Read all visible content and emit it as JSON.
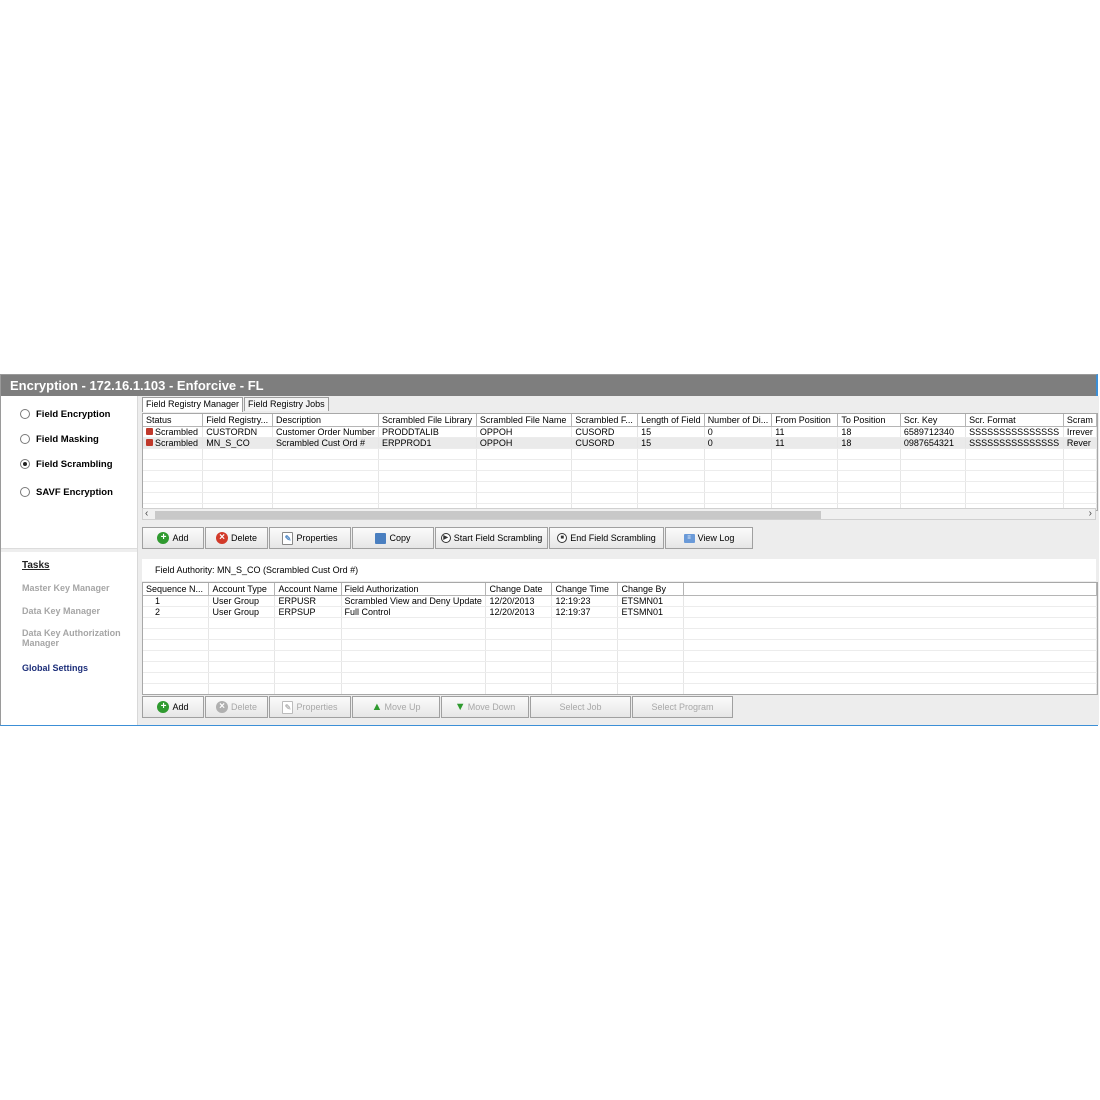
{
  "window": {
    "title": "Encryption - 172.16.1.103 - Enforcive - FL"
  },
  "left_panel": {
    "options": [
      {
        "label": "Field Encryption",
        "selected": false
      },
      {
        "label": "Field Masking",
        "selected": false
      },
      {
        "label": "Field Scrambling",
        "selected": true
      },
      {
        "label": "SAVF Encryption",
        "selected": false
      }
    ],
    "tasks_heading": "Tasks",
    "tasks": [
      {
        "label": "Master Key Manager",
        "enabled": false
      },
      {
        "label": "Data Key Manager",
        "enabled": false
      },
      {
        "label": "Data Key Authorization Manager",
        "enabled": false
      },
      {
        "label": "Global Settings",
        "enabled": true
      }
    ]
  },
  "tabs": [
    {
      "label": "Field Registry Manager",
      "active": true
    },
    {
      "label": "Field Registry Jobs",
      "active": false
    }
  ],
  "registry_grid": {
    "columns": [
      "Status",
      "Field Registry...",
      "Description",
      "Scrambled File Library",
      "Scrambled File Name",
      "Scrambled F...",
      "Length of Field",
      "Number of Di...",
      "From Position",
      "To Position",
      "Scr. Key",
      "Scr. Format",
      "Scram"
    ],
    "rows": [
      [
        "Scrambled",
        "CUSTORDN",
        "Customer Order Number",
        "PRODDTALIB",
        "OPPOH",
        "CUSORD",
        "15",
        "0",
        "11",
        "18",
        "6589712340",
        "SSSSSSSSSSSSSSS",
        "Irrever"
      ],
      [
        "Scrambled",
        "MN_S_CO",
        "Scrambled Cust Ord #",
        "ERPPROD1",
        "OPPOH",
        "CUSORD",
        "15",
        "0",
        "11",
        "18",
        "0987654321",
        "SSSSSSSSSSSSSSS",
        "Rever"
      ]
    ],
    "selected_row": 1,
    "status_icon": "lock-icon"
  },
  "toolbar_top": {
    "buttons": [
      {
        "label": "Add",
        "icon": "plus-icon"
      },
      {
        "label": "Delete",
        "icon": "delete-icon"
      },
      {
        "label": "Properties",
        "icon": "properties-icon"
      },
      {
        "label": "Copy",
        "icon": "copy-icon"
      },
      {
        "label": "Start Field Scrambling",
        "icon": "play-icon"
      },
      {
        "label": "End Field Scrambling",
        "icon": "stop-icon"
      },
      {
        "label": "View Log",
        "icon": "log-icon"
      }
    ]
  },
  "field_authority": {
    "label": "Field Authority:",
    "value": "MN_S_CO (Scrambled Cust Ord #)"
  },
  "authority_grid": {
    "columns": [
      "Sequence N...",
      "Account Type",
      "Account Name",
      "Field Authorization",
      "Change Date",
      "Change Time",
      "Change By"
    ],
    "rows": [
      [
        "1",
        "User Group",
        "ERPUSR",
        "Scrambled View and Deny Update",
        "12/20/2013",
        "12:19:23",
        "ETSMN01"
      ],
      [
        "2",
        "User Group",
        "ERPSUP",
        "Full Control",
        "12/20/2013",
        "12:19:37",
        "ETSMN01"
      ]
    ]
  },
  "toolbar_bottom": {
    "buttons": [
      {
        "label": "Add",
        "icon": "plus-icon",
        "enabled": true
      },
      {
        "label": "Delete",
        "icon": "delete-icon",
        "enabled": false
      },
      {
        "label": "Properties",
        "icon": "properties-icon",
        "enabled": false
      },
      {
        "label": "Move Up",
        "icon": "arrow-up-icon",
        "enabled": false
      },
      {
        "label": "Move Down",
        "icon": "arrow-down-icon",
        "enabled": false
      },
      {
        "label": "Select Job",
        "icon": "",
        "enabled": false
      },
      {
        "label": "Select Program",
        "icon": "",
        "enabled": false
      }
    ]
  },
  "colors": {
    "titlebar": "#7e7e7e",
    "window_border_accent": "#3c8fd6",
    "active_task": "#1d2f7a"
  }
}
